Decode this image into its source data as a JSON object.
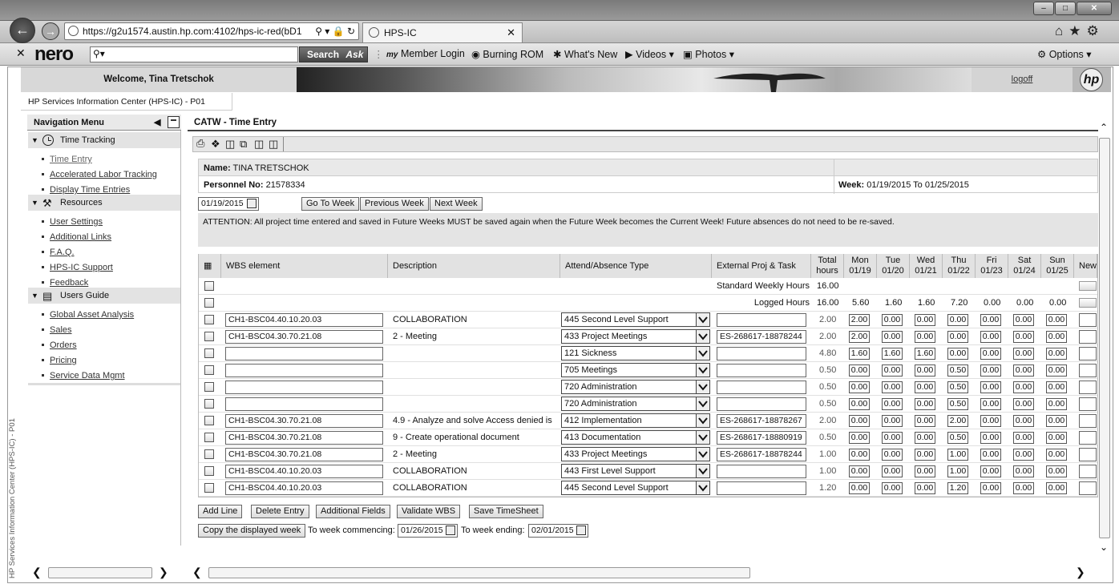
{
  "browser": {
    "url": "https://g2u1574.austin.hp.com:4102/hps-ic-red(bD1",
    "tab_title": "HPS-IC",
    "search_button": "Search",
    "ask_label": "Ask",
    "toolbar_items": [
      "Member Login",
      "Burning ROM",
      "What's New",
      "Videos",
      "Photos"
    ],
    "options_label": "Options",
    "nero_logo": "nero"
  },
  "header": {
    "welcome": "Welcome, Tina Tretschok",
    "logoff": "logoff",
    "subtitle": "HP Services Information Center (HPS-IC) - P01",
    "side_vertical": "HP Services Information Center (HPS-IC) - P01",
    "hp_logo": "hp"
  },
  "nav": {
    "title": "Navigation Menu",
    "sections": [
      {
        "label": "Time Tracking",
        "icon": "clock-icon",
        "items": [
          "Time Entry",
          "Accelerated Labor Tracking",
          "Display Time Entries"
        ]
      },
      {
        "label": "Resources",
        "icon": "resources-icon",
        "items": [
          "User Settings",
          "Additional Links",
          "F.A.Q.",
          "HPS-IC Support",
          "Feedback"
        ]
      },
      {
        "label": "Users Guide",
        "icon": "book-icon",
        "items": [
          "Global Asset Analysis",
          "Sales",
          "Orders",
          "Pricing",
          "Service Data Mgmt"
        ]
      }
    ]
  },
  "main": {
    "title": "CATW - Time Entry",
    "name_label": "Name:",
    "name_value": "TINA TRETSCHOK",
    "personnel_label": "Personnel No:",
    "personnel_value": "21578334",
    "week_label": "Week:",
    "week_value": "01/19/2015 To 01/25/2015",
    "date_input": "01/19/2015",
    "go_to_week": "Go To Week",
    "previous_week": "Previous Week",
    "next_week": "Next Week",
    "attention": "ATTENTION: All project time entered and saved in Future Weeks MUST be saved again when the Future Week becomes the Current Week! Future absences do not need to be re-saved."
  },
  "grid": {
    "headers": {
      "wbs": "WBS element",
      "description": "Description",
      "attend": "Attend/Absence Type",
      "external": "External Proj & Task",
      "total": [
        "Total",
        "hours"
      ],
      "days": [
        [
          "Mon",
          "01/19"
        ],
        [
          "Tue",
          "01/20"
        ],
        [
          "Wed",
          "01/21"
        ],
        [
          "Thu",
          "01/22"
        ],
        [
          "Fri",
          "01/23"
        ],
        [
          "Sat",
          "01/24"
        ],
        [
          "Sun",
          "01/25"
        ]
      ],
      "new": "New"
    },
    "summary": [
      {
        "label": "Standard Weekly Hours",
        "total": "16.00",
        "days": [
          "",
          "",
          "",
          "",
          "",
          "",
          ""
        ]
      },
      {
        "label": "Logged Hours",
        "total": "16.00",
        "days": [
          "5.60",
          "1.60",
          "1.60",
          "7.20",
          "0.00",
          "0.00",
          "0.00"
        ]
      }
    ],
    "rows": [
      {
        "wbs": "CH1-BSC04.40.10.20.03",
        "desc": "COLLABORATION",
        "type": "445 Second Level Support",
        "ext": "",
        "total": "2.00",
        "days": [
          "2.00",
          "0.00",
          "0.00",
          "0.00",
          "0.00",
          "0.00",
          "0.00"
        ]
      },
      {
        "wbs": "CH1-BSC04.30.70.21.08",
        "desc": "2 - Meeting",
        "type": "433 Project Meetings",
        "ext": "ES-268617-18878244",
        "total": "2.00",
        "days": [
          "2.00",
          "0.00",
          "0.00",
          "0.00",
          "0.00",
          "0.00",
          "0.00"
        ]
      },
      {
        "wbs": "",
        "desc": "",
        "type": "121 Sickness",
        "ext": "",
        "total": "4.80",
        "days": [
          "1.60",
          "1.60",
          "1.60",
          "0.00",
          "0.00",
          "0.00",
          "0.00"
        ]
      },
      {
        "wbs": "",
        "desc": "",
        "type": "705 Meetings",
        "ext": "",
        "total": "0.50",
        "days": [
          "0.00",
          "0.00",
          "0.00",
          "0.50",
          "0.00",
          "0.00",
          "0.00"
        ]
      },
      {
        "wbs": "",
        "desc": "",
        "type": "720 Administration",
        "ext": "",
        "total": "0.50",
        "days": [
          "0.00",
          "0.00",
          "0.00",
          "0.50",
          "0.00",
          "0.00",
          "0.00"
        ]
      },
      {
        "wbs": "",
        "desc": "",
        "type": "720 Administration",
        "ext": "",
        "total": "0.50",
        "days": [
          "0.00",
          "0.00",
          "0.00",
          "0.50",
          "0.00",
          "0.00",
          "0.00"
        ]
      },
      {
        "wbs": "CH1-BSC04.30.70.21.08",
        "desc": "4.9 - Analyze and solve Access denied is",
        "type": "412 Implementation",
        "ext": "ES-268617-18878267",
        "total": "2.00",
        "days": [
          "0.00",
          "0.00",
          "0.00",
          "2.00",
          "0.00",
          "0.00",
          "0.00"
        ]
      },
      {
        "wbs": "CH1-BSC04.30.70.21.08",
        "desc": "9 - Create operational document",
        "type": "413 Documentation",
        "ext": "ES-268617-18880919",
        "total": "0.50",
        "days": [
          "0.00",
          "0.00",
          "0.00",
          "0.50",
          "0.00",
          "0.00",
          "0.00"
        ]
      },
      {
        "wbs": "CH1-BSC04.30.70.21.08",
        "desc": "2 - Meeting",
        "type": "433 Project Meetings",
        "ext": "ES-268617-18878244",
        "total": "1.00",
        "days": [
          "0.00",
          "0.00",
          "0.00",
          "1.00",
          "0.00",
          "0.00",
          "0.00"
        ]
      },
      {
        "wbs": "CH1-BSC04.40.10.20.03",
        "desc": "COLLABORATION",
        "type": "443 First Level Support",
        "ext": "",
        "total": "1.00",
        "days": [
          "0.00",
          "0.00",
          "0.00",
          "1.00",
          "0.00",
          "0.00",
          "0.00"
        ]
      },
      {
        "wbs": "CH1-BSC04.40.10.20.03",
        "desc": "COLLABORATION",
        "type": "445 Second Level Support",
        "ext": "",
        "total": "1.20",
        "days": [
          "0.00",
          "0.00",
          "0.00",
          "1.20",
          "0.00",
          "0.00",
          "0.00"
        ]
      }
    ]
  },
  "actions": {
    "add_line": "Add Line",
    "delete_entry": "Delete Entry",
    "additional_fields": "Additional Fields",
    "validate_wbs": "Validate WBS",
    "save_timesheet": "Save TimeSheet",
    "copy_week": "Copy the displayed week",
    "to_week_commencing": "To week commencing:",
    "commencing_date": "01/26/2015",
    "to_week_ending": "To week ending:",
    "ending_date": "02/01/2015"
  }
}
